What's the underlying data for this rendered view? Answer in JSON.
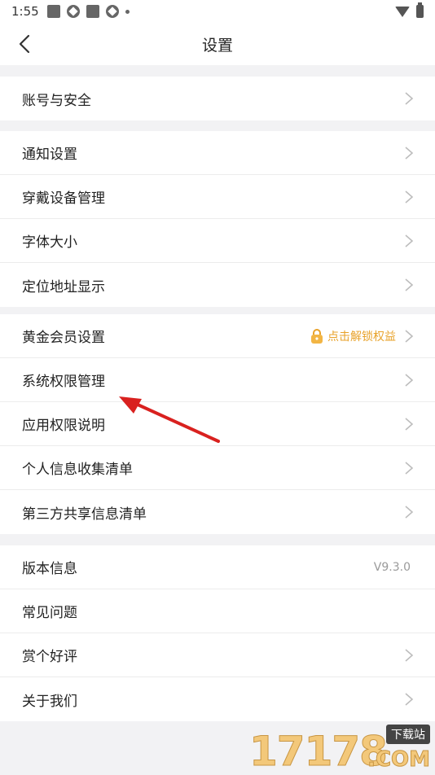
{
  "status_bar": {
    "time": "1:55"
  },
  "header": {
    "title": "设置"
  },
  "groups": [
    {
      "items": [
        {
          "label": "账号与安全"
        }
      ]
    },
    {
      "items": [
        {
          "label": "通知设置"
        },
        {
          "label": "穿戴设备管理"
        },
        {
          "label": "字体大小"
        },
        {
          "label": "定位地址显示"
        }
      ]
    },
    {
      "items": [
        {
          "label": "黄金会员设置",
          "hint": "点击解锁权益"
        },
        {
          "label": "系统权限管理"
        },
        {
          "label": "应用权限说明"
        },
        {
          "label": "个人信息收集清单"
        },
        {
          "label": "第三方共享信息清单"
        }
      ]
    },
    {
      "items": [
        {
          "label": "版本信息",
          "value": "V9.3.0"
        },
        {
          "label": "常见问题"
        },
        {
          "label": "赏个好评"
        },
        {
          "label": "关于我们"
        }
      ]
    }
  ],
  "watermark": {
    "number": "17178",
    "badge": "下载站",
    "suffix": ".COM"
  },
  "colors": {
    "accent": "#e8a22a",
    "arrow": "#d9211f",
    "background": "#f2f2f4"
  }
}
